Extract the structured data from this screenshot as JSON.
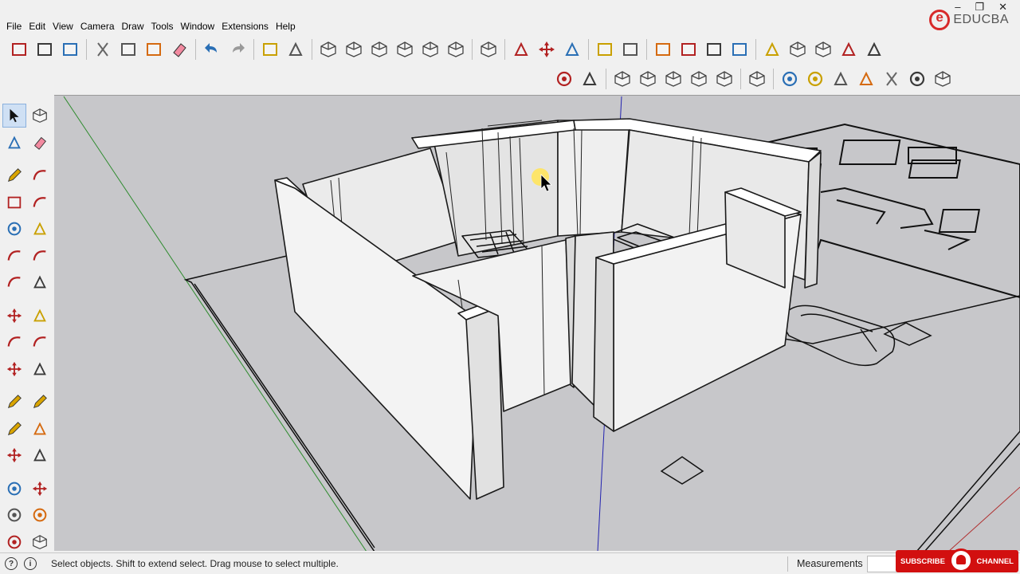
{
  "menu": [
    "File",
    "Edit",
    "View",
    "Camera",
    "Draw",
    "Tools",
    "Window",
    "Extensions",
    "Help"
  ],
  "window_controls": {
    "minimize": "–",
    "restore": "❐",
    "close": "✕"
  },
  "logo": {
    "text": "EDUCBA"
  },
  "toolbar1": [
    [
      "new-icon",
      "open-icon",
      "save-icon"
    ],
    [
      "cut-icon",
      "copy-icon",
      "paste-icon",
      "erase-icon"
    ],
    [
      "undo-icon",
      "redo-icon"
    ],
    [
      "print-icon",
      "model-info-icon"
    ],
    [
      "iso-view-icon",
      "top-view-icon",
      "front-view-icon",
      "right-view-icon",
      "back-view-icon",
      "left-view-icon"
    ],
    [
      "components-icon"
    ],
    [
      "teapot-icon",
      "hand-icon",
      "cloud-icon"
    ],
    [
      "section-plane-icon",
      "section-fill-icon"
    ],
    [
      "window-icon",
      "style-icon",
      "shadow-icon",
      "lock-icon"
    ],
    [
      "ruby-icon",
      "box-icon",
      "box-edit-icon",
      "plant-icon",
      "paint-icon"
    ]
  ],
  "toolbar2": [
    [
      "sphere-icon",
      "intersect-icon"
    ],
    [
      "cube-wire-icon",
      "cube-hidden-icon",
      "cube-shaded-icon",
      "cube-textured-icon",
      "cube-mono-icon"
    ],
    [
      "view-cursor-icon"
    ],
    [
      "sun-icon",
      "circle-sun-icon",
      "cone-icon",
      "lamp-icon",
      "sparkle-icon",
      "dome-icon",
      "cube-grey-icon"
    ]
  ],
  "palette": [
    [
      "select-icon",
      "make-component-icon"
    ],
    [
      "paint-bucket-icon",
      "eraser-icon"
    ],
    [
      "pencil-icon",
      "freehand-icon"
    ],
    [
      "rectangle-icon",
      "rotated-rectangle-icon"
    ],
    [
      "circle-icon",
      "polygon-icon"
    ],
    [
      "arc-icon",
      "two-point-arc-icon"
    ],
    [
      "three-point-arc-icon",
      "pie-icon"
    ],
    [
      "move-icon",
      "push-pull-icon"
    ],
    [
      "rotate-icon",
      "follow-me-icon"
    ],
    [
      "scale-icon",
      "offset-icon"
    ],
    [
      "tape-measure-icon",
      "dimension-icon"
    ],
    [
      "protractor-icon",
      "text-icon"
    ],
    [
      "axes-icon",
      "3d-text-icon"
    ],
    [
      "orbit-icon",
      "pan-icon"
    ],
    [
      "zoom-icon",
      "zoom-window-icon"
    ],
    [
      "zoom-extents-icon",
      "previous-view-icon"
    ]
  ],
  "status": {
    "text": "Select objects. Shift to extend select. Drag mouse to select multiple.",
    "measurements_label": "Measurements",
    "measurements_value": ""
  },
  "subscribe": {
    "left": "SUBSCRIBE",
    "right": "CHANNEL"
  },
  "colors": {
    "viewport_bg": "#c7c7ca",
    "wall_face": "#f4f4f4",
    "wall_shade": "#e7e7e7",
    "edge": "#1a1a1a",
    "axis_green": "#2e8b2e",
    "axis_blue": "#2323b0",
    "axis_red": "#b03030",
    "accent_red": "#d20f0f"
  }
}
